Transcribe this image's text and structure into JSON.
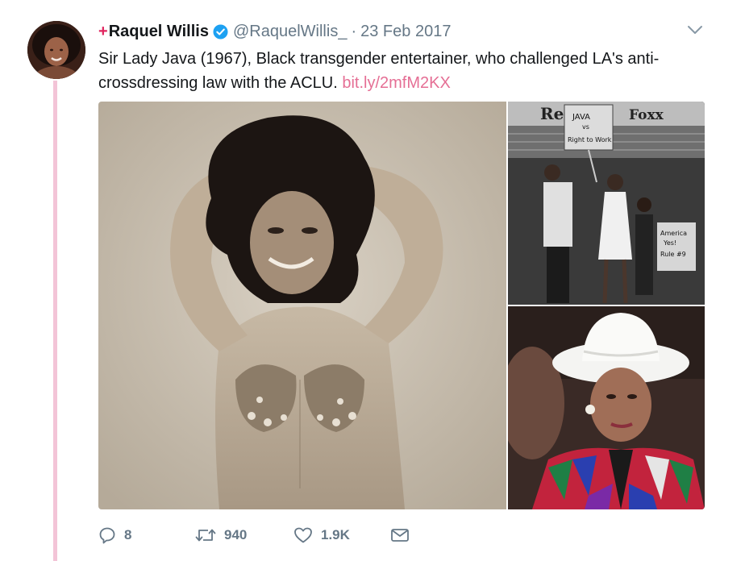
{
  "tweet": {
    "retweet_mark": "+",
    "display_name": "Raquel Willis",
    "verified_icon": "verified-badge-icon",
    "handle": "@RaquelWillis_",
    "separator": "·",
    "date": "23 Feb 2017",
    "text": "Sir Lady Java (1967), Black transgender entertainer, who challenged LA's anti-crossdressing law with the ACLU. ",
    "link": "bit.ly/2mfM2KX",
    "menu_icon": "chevron-down-icon",
    "accent_color": "#e56f95",
    "thread_color": "#f3c4d7",
    "verified_color": "#1da1f2"
  },
  "media": {
    "photos": [
      {
        "name": "photo-sepia-dancer",
        "desc": "sepia portrait"
      },
      {
        "name": "photo-protest",
        "sign_texts": [
          "Re",
          "Foxx",
          "JAVA",
          "vs",
          "Right to Work",
          "America",
          "Yes!",
          "Rule #9"
        ]
      },
      {
        "name": "photo-woman-white-hat"
      }
    ]
  },
  "actions": {
    "reply": {
      "icon": "reply-icon",
      "count": "8"
    },
    "retweet": {
      "icon": "retweet-icon",
      "count": "940"
    },
    "like": {
      "icon": "heart-icon",
      "count": "1.9K"
    },
    "message": {
      "icon": "envelope-icon"
    }
  }
}
